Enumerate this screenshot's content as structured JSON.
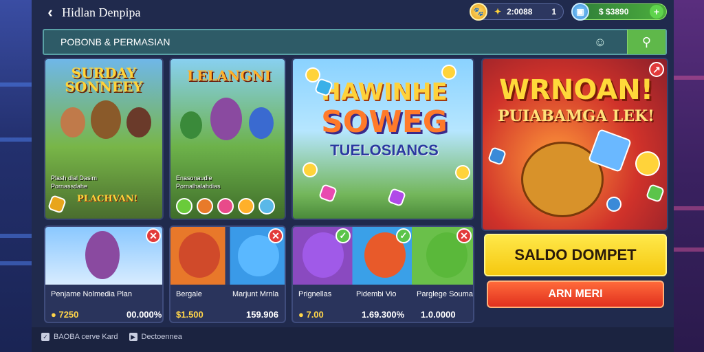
{
  "header": {
    "title": "Hidlan Denpipa",
    "balance_1": "2:0088",
    "balance_1_suffix": "1",
    "balance_2": "$ $3890"
  },
  "search": {
    "label": "POBONB & PERMASIAN"
  },
  "featured": [
    {
      "title": "SURDAY SONNEEY",
      "sub1": "Plash dial Dasim",
      "sub2": "Pornassdahe",
      "sub3": "PLACHVAN!"
    },
    {
      "title": "LELANGNI",
      "sub1": "Enasonaudie",
      "sub2": "Pornalhalahdias"
    },
    {
      "title1": "HAWINHE",
      "title2": "SOWEG",
      "title3": "TUELOSIANCS"
    },
    {
      "title1": "WRNOAN!",
      "title2": "PUIABAMGA LEK!"
    }
  ],
  "games": [
    {
      "name": "Penjame Nolmedia Plan",
      "price": "7250",
      "value": "00.000%"
    },
    {
      "name": "Bergale",
      "price": "$1.500",
      "value": "Marjunt Mrnla"
    },
    {
      "name": "Prignellas",
      "price": "7.00",
      "value": "159.906"
    },
    {
      "name": "Pidembi Vio",
      "price": "",
      "value": "1.69.300%"
    },
    {
      "name": "Parglege Souma",
      "price": "",
      "value": "1.0.0000"
    }
  ],
  "actions": {
    "saldo": "SALDO DOMPET",
    "arn": "ARN MERI"
  },
  "footer": {
    "item1": "BAOBA cerve Kard",
    "item2": "Dectoennea"
  },
  "colors": {
    "accent_yellow": "#f5c810",
    "accent_red": "#e0301e",
    "accent_green": "#5fb84a",
    "bg": "#202a4d"
  }
}
